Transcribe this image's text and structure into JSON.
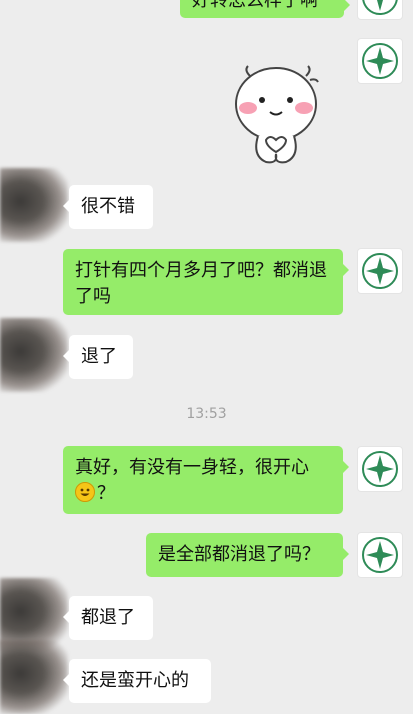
{
  "messages": [
    {
      "side": "out",
      "text": "好转怎么样了啊"
    },
    {
      "side": "out",
      "sticker": "hand-heart-sticker"
    },
    {
      "side": "in",
      "text": "很不错"
    },
    {
      "side": "out",
      "text": "打针有四个月多月了吧？都消退了吗"
    },
    {
      "side": "in",
      "text": "退了"
    },
    {
      "side": "out",
      "text": "真好，有没有一身轻，很开心",
      "emoji": "smile-emoji",
      "tail": "？"
    },
    {
      "side": "out",
      "text": "是全部都消退了吗？"
    },
    {
      "side": "in",
      "text": "都退了"
    },
    {
      "side": "in",
      "text": "还是蛮开心的"
    }
  ],
  "timestamp": "13:53",
  "colors": {
    "outgoing_bubble": "#95ec69",
    "incoming_bubble": "#ffffff",
    "background": "#ededed"
  }
}
